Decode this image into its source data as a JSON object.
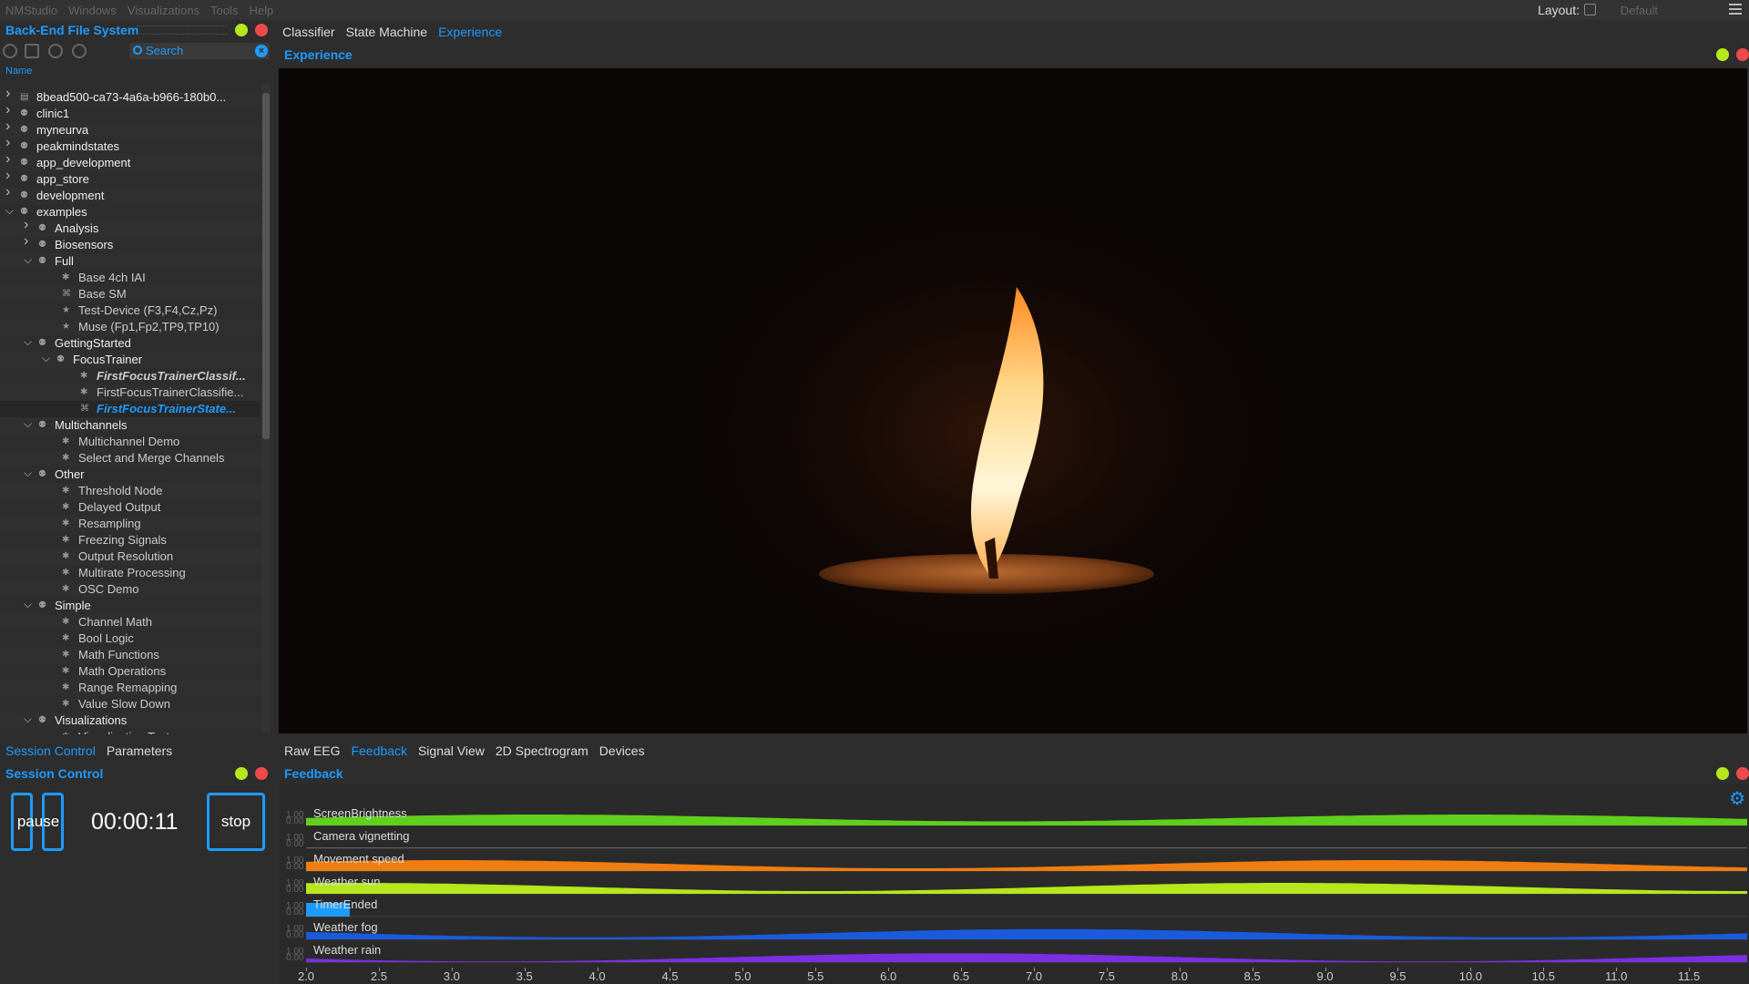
{
  "menubar": {
    "items": [
      "NMStudio",
      "Windows",
      "Visualizations",
      "Tools",
      "Help"
    ],
    "layout_label": "Layout:",
    "layout_value": "Default"
  },
  "filesystem": {
    "title": "Back-End File System",
    "search_placeholder": "Search",
    "column_header": "Name",
    "rows": [
      {
        "label": "8bead500-ca73-4a6a-b966-180b0...",
        "depth": 0,
        "chev": "right",
        "icon": "folder"
      },
      {
        "label": "clinic1",
        "depth": 0,
        "chev": "right",
        "icon": "group"
      },
      {
        "label": "myneurva",
        "depth": 0,
        "chev": "right",
        "icon": "group"
      },
      {
        "label": "peakmindstates",
        "depth": 0,
        "chev": "right",
        "icon": "group"
      },
      {
        "label": "app_development",
        "depth": 0,
        "chev": "right",
        "icon": "group"
      },
      {
        "label": "app_store",
        "depth": 0,
        "chev": "right",
        "icon": "group"
      },
      {
        "label": "development",
        "depth": 0,
        "chev": "right",
        "icon": "group"
      },
      {
        "label": "examples",
        "depth": 0,
        "chev": "down",
        "icon": "group"
      },
      {
        "label": "Analysis",
        "depth": 1,
        "chev": "right",
        "icon": "group"
      },
      {
        "label": "Biosensors",
        "depth": 1,
        "chev": "right",
        "icon": "group"
      },
      {
        "label": "Full",
        "depth": 1,
        "chev": "down",
        "icon": "group"
      },
      {
        "label": "Base 4ch IAI",
        "depth": 2,
        "chev": "",
        "icon": "node"
      },
      {
        "label": "Base SM",
        "depth": 2,
        "chev": "",
        "icon": "sm"
      },
      {
        "label": "Test-Device (F3,F4,Cz,Pz)",
        "depth": 2,
        "chev": "",
        "icon": "star"
      },
      {
        "label": "Muse (Fp1,Fp2,TP9,TP10)",
        "depth": 2,
        "chev": "",
        "icon": "star"
      },
      {
        "label": "GettingStarted",
        "depth": 1,
        "chev": "down",
        "icon": "group"
      },
      {
        "label": "FocusTrainer",
        "depth": 2,
        "chev": "down",
        "icon": "group"
      },
      {
        "label": "FirstFocusTrainerClassif...",
        "depth": 3,
        "chev": "",
        "icon": "node",
        "style": "italic"
      },
      {
        "label": "FirstFocusTrainerClassifie...",
        "depth": 3,
        "chev": "",
        "icon": "node"
      },
      {
        "label": "FirstFocusTrainerState...",
        "depth": 3,
        "chev": "",
        "icon": "sm",
        "style": "selected"
      },
      {
        "label": "Multichannels",
        "depth": 1,
        "chev": "down",
        "icon": "group"
      },
      {
        "label": "Multichannel Demo",
        "depth": 2,
        "chev": "",
        "icon": "node"
      },
      {
        "label": "Select and Merge Channels",
        "depth": 2,
        "chev": "",
        "icon": "node"
      },
      {
        "label": "Other",
        "depth": 1,
        "chev": "down",
        "icon": "group"
      },
      {
        "label": "Threshold Node",
        "depth": 2,
        "chev": "",
        "icon": "node"
      },
      {
        "label": "Delayed Output",
        "depth": 2,
        "chev": "",
        "icon": "node"
      },
      {
        "label": "Resampling",
        "depth": 2,
        "chev": "",
        "icon": "node"
      },
      {
        "label": "Freezing Signals",
        "depth": 2,
        "chev": "",
        "icon": "node"
      },
      {
        "label": "Output Resolution",
        "depth": 2,
        "chev": "",
        "icon": "node"
      },
      {
        "label": "Multirate Processing",
        "depth": 2,
        "chev": "",
        "icon": "node"
      },
      {
        "label": "OSC Demo",
        "depth": 2,
        "chev": "",
        "icon": "node"
      },
      {
        "label": "Simple",
        "depth": 1,
        "chev": "down",
        "icon": "group"
      },
      {
        "label": "Channel Math",
        "depth": 2,
        "chev": "",
        "icon": "node"
      },
      {
        "label": "Bool Logic",
        "depth": 2,
        "chev": "",
        "icon": "node"
      },
      {
        "label": "Math Functions",
        "depth": 2,
        "chev": "",
        "icon": "node"
      },
      {
        "label": "Math Operations",
        "depth": 2,
        "chev": "",
        "icon": "node"
      },
      {
        "label": "Range Remapping",
        "depth": 2,
        "chev": "",
        "icon": "node"
      },
      {
        "label": "Value Slow Down",
        "depth": 2,
        "chev": "",
        "icon": "node"
      },
      {
        "label": "Visualizations",
        "depth": 1,
        "chev": "down",
        "icon": "group"
      },
      {
        "label": "Visualization Test",
        "depth": 2,
        "chev": "",
        "icon": "node"
      }
    ]
  },
  "main_tabs": [
    {
      "label": "Classifier",
      "active": false
    },
    {
      "label": "State Machine",
      "active": false
    },
    {
      "label": "Experience",
      "active": true
    }
  ],
  "experience": {
    "title": "Experience"
  },
  "session_tabs": [
    {
      "label": "Session Control",
      "active": true
    },
    {
      "label": "Parameters",
      "active": false
    }
  ],
  "session": {
    "title": "Session Control",
    "pause_label": "pause",
    "stop_label": "stop",
    "timer": "00:00:11"
  },
  "feedback_tabs": [
    {
      "label": "Raw EEG",
      "active": false
    },
    {
      "label": "Feedback",
      "active": true
    },
    {
      "label": "Signal View",
      "active": false
    },
    {
      "label": "2D Spectrogram",
      "active": false
    },
    {
      "label": "Devices",
      "active": false
    }
  ],
  "feedback": {
    "title": "Feedback",
    "y_tick_labels": [
      "1.00",
      "0.00"
    ],
    "x_ticks": [
      "2.0",
      "2.5",
      "3.0",
      "3.5",
      "4.0",
      "4.5",
      "5.0",
      "5.5",
      "6.0",
      "6.5",
      "7.0",
      "7.5",
      "8.0",
      "8.5",
      "9.0",
      "9.5",
      "10.0",
      "10.5",
      "11.0",
      "11.5"
    ],
    "x_range": [
      2.0,
      11.9
    ],
    "tracks": [
      {
        "name": "ScreenBrightness",
        "color": "#5fd01c",
        "kind": "wave",
        "base": 0.55,
        "amp": 0.25,
        "phase": 0.0
      },
      {
        "name": "Camera vignetting",
        "color": "#9a9a9a",
        "kind": "flat",
        "base": 0.03
      },
      {
        "name": "Movement speed",
        "color": "#f07d10",
        "kind": "wave",
        "base": 0.5,
        "amp": 0.3,
        "phase": 0.2
      },
      {
        "name": "Weather sun",
        "color": "#b6e61c",
        "kind": "wave",
        "base": 0.5,
        "amp": 0.3,
        "phase": 0.4
      },
      {
        "name": "TimerEnded",
        "color": "#1e9bff",
        "kind": "pulse",
        "pulse_end": 2.3
      },
      {
        "name": "Weather fog",
        "color": "#1a5adc",
        "kind": "wave",
        "base": 0.45,
        "amp": 0.3,
        "phase": 0.9
      },
      {
        "name": "Weather rain",
        "color": "#7b2fe0",
        "kind": "wave",
        "base": 0.35,
        "amp": 0.3,
        "phase": 1.1
      }
    ]
  }
}
